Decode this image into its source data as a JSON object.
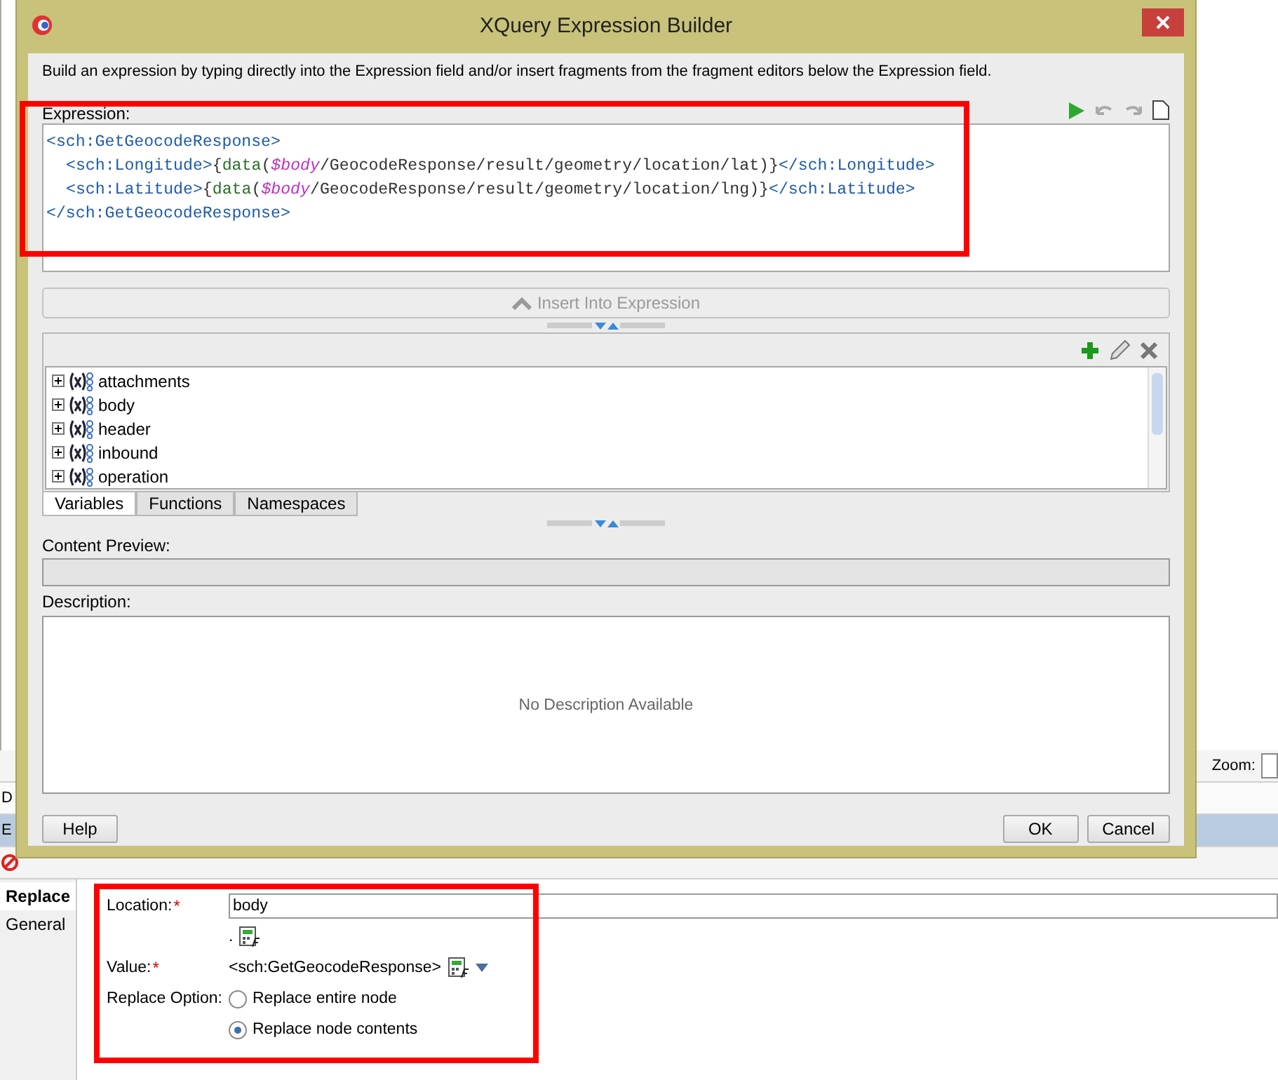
{
  "dialog": {
    "title": "XQuery Expression Builder",
    "instructions": "Build an expression by typing directly into the Expression field and/or insert fragments from the fragment editors below the Expression field.",
    "expression_label": "Expression:",
    "expression_lines": [
      {
        "indented": false,
        "segments": [
          {
            "kind": "tag",
            "text": "<sch:GetGeocodeResponse>"
          }
        ]
      },
      {
        "indented": true,
        "segments": [
          {
            "kind": "tag",
            "text": "<sch:Longitude>"
          },
          {
            "kind": "text",
            "text": "{"
          },
          {
            "kind": "func",
            "text": "data"
          },
          {
            "kind": "text",
            "text": "("
          },
          {
            "kind": "var",
            "text": "$body"
          },
          {
            "kind": "text",
            "text": "/GeocodeResponse/result/geometry/location/lat)}"
          },
          {
            "kind": "tag",
            "text": "</sch:Longitude>"
          }
        ]
      },
      {
        "indented": true,
        "segments": [
          {
            "kind": "tag",
            "text": "<sch:Latitude>"
          },
          {
            "kind": "text",
            "text": "{"
          },
          {
            "kind": "func",
            "text": "data"
          },
          {
            "kind": "text",
            "text": "("
          },
          {
            "kind": "var",
            "text": "$body"
          },
          {
            "kind": "text",
            "text": "/GeocodeResponse/result/geometry/location/lng)}"
          },
          {
            "kind": "tag",
            "text": "</sch:Latitude>"
          }
        ]
      },
      {
        "indented": false,
        "segments": [
          {
            "kind": "tag",
            "text": "</sch:GetGeocodeResponse>"
          }
        ]
      }
    ],
    "insert_button": {
      "label": "Insert Into Expression",
      "disabled": true
    },
    "tree_items": [
      {
        "label": "attachments",
        "expanded": false
      },
      {
        "label": "body",
        "expanded": false
      },
      {
        "label": "header",
        "expanded": false
      },
      {
        "label": "inbound",
        "expanded": false
      },
      {
        "label": "operation",
        "expanded": false
      }
    ],
    "tabs": [
      {
        "label": "Variables",
        "selected": true
      },
      {
        "label": "Functions",
        "selected": false
      },
      {
        "label": "Namespaces",
        "selected": false
      }
    ],
    "content_preview_label": "Content Preview:",
    "description_label": "Description:",
    "description_text": "No Description Available",
    "help_button": "Help",
    "buttons": [
      "OK",
      "Cancel"
    ]
  },
  "background": {
    "zoom_label": "Zoom:",
    "side_letters": [
      "D",
      "E"
    ]
  },
  "properties": {
    "side_tabs": [
      {
        "label": "Replace",
        "selected": true
      },
      {
        "label": "General",
        "selected": false
      }
    ],
    "location": {
      "label": "Location:",
      "required_mark": "*",
      "value": "body",
      "hint": "."
    },
    "value": {
      "label": "Value:",
      "required_mark": "*",
      "value": "<sch:GetGeocodeResponse>"
    },
    "replace_option": {
      "label": "Replace Option:",
      "options": [
        {
          "label": "Replace entire node",
          "selected": false
        },
        {
          "label": "Replace node contents",
          "selected": true
        }
      ]
    }
  }
}
